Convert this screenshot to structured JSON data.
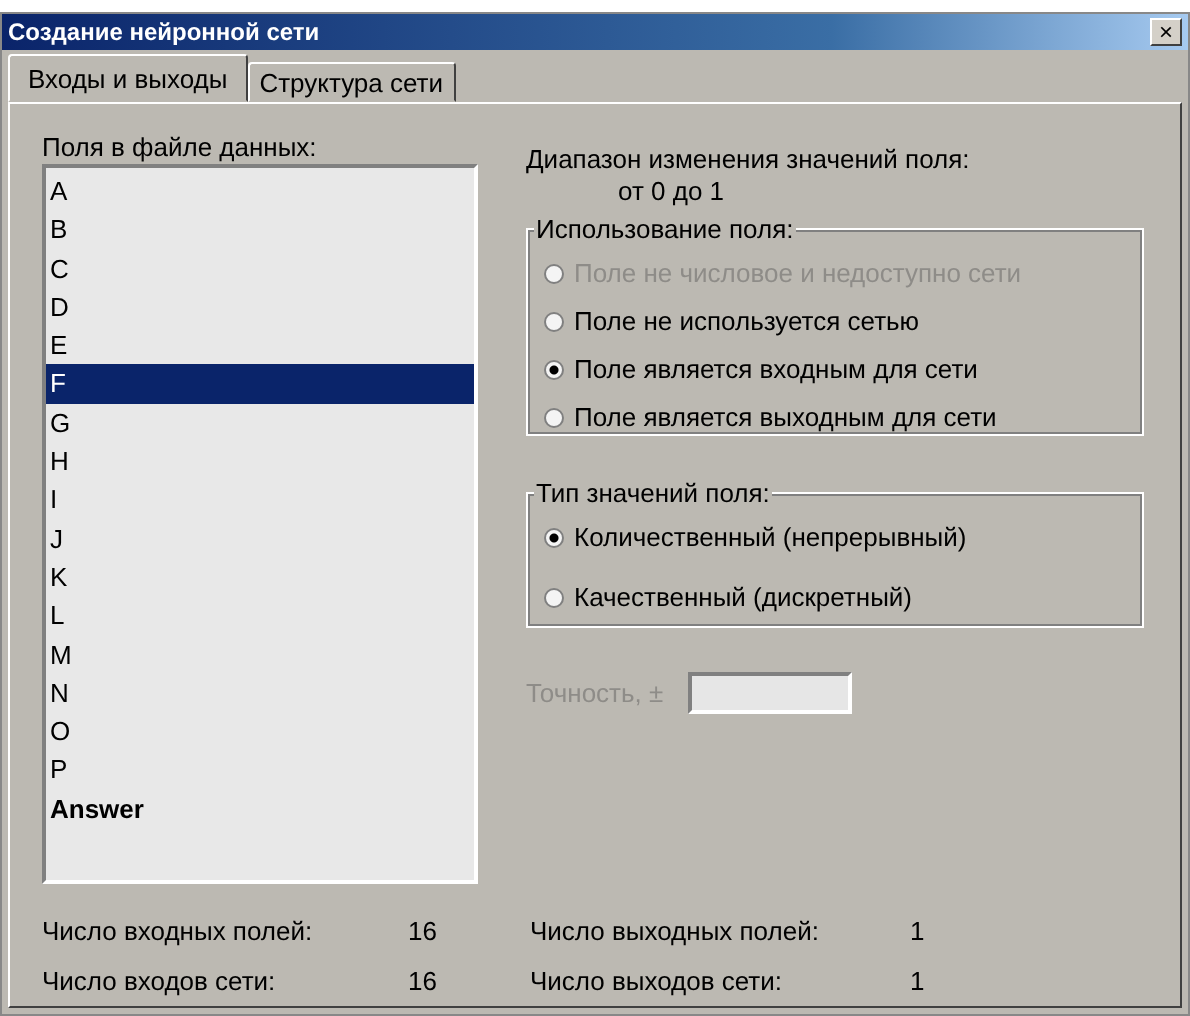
{
  "window": {
    "title": "Создание нейронной сети",
    "close": "×"
  },
  "tabs": [
    {
      "label": "Входы и выходы",
      "selected": true
    },
    {
      "label": "Структура сети",
      "selected": false
    }
  ],
  "fields": {
    "label": "Поля в файле данных:",
    "items": [
      {
        "name": "A",
        "kind": "field",
        "selected": false
      },
      {
        "name": "B",
        "kind": "field",
        "selected": false
      },
      {
        "name": "C",
        "kind": "field",
        "selected": false
      },
      {
        "name": "D",
        "kind": "field",
        "selected": false
      },
      {
        "name": "E",
        "kind": "field",
        "selected": false
      },
      {
        "name": "F",
        "kind": "field",
        "selected": true
      },
      {
        "name": "G",
        "kind": "field",
        "selected": false
      },
      {
        "name": "H",
        "kind": "field",
        "selected": false
      },
      {
        "name": "I",
        "kind": "field",
        "selected": false
      },
      {
        "name": "J",
        "kind": "field",
        "selected": false
      },
      {
        "name": "K",
        "kind": "field",
        "selected": false
      },
      {
        "name": "L",
        "kind": "field",
        "selected": false
      },
      {
        "name": "M",
        "kind": "field",
        "selected": false
      },
      {
        "name": "N",
        "kind": "field",
        "selected": false
      },
      {
        "name": "O",
        "kind": "field",
        "selected": false
      },
      {
        "name": "P",
        "kind": "field",
        "selected": false
      },
      {
        "name": "Answer",
        "kind": "target",
        "selected": false
      }
    ]
  },
  "range": {
    "label": "Диапазон изменения значений поля:",
    "value": "от 0 до 1"
  },
  "usage": {
    "title": "Использование поля:",
    "options": [
      {
        "label": "Поле не числовое и недоступно сети",
        "selected": false,
        "disabled": true
      },
      {
        "label": "Поле не используется сетью",
        "selected": false,
        "disabled": false
      },
      {
        "label": "Поле является входным для сети",
        "selected": true,
        "disabled": false
      },
      {
        "label": "Поле является выходным для сети",
        "selected": false,
        "disabled": false
      }
    ]
  },
  "value_type": {
    "title": "Тип значений поля:",
    "options": [
      {
        "label": "Количественный (непрерывный)",
        "selected": true,
        "disabled": false
      },
      {
        "label": "Качественный (дискретный)",
        "selected": false,
        "disabled": false
      }
    ]
  },
  "precision": {
    "label": "Точность, ±",
    "disabled": true
  },
  "stats": [
    {
      "label": "Число входных полей:",
      "value": "16"
    },
    {
      "label": "Число выходных полей:",
      "value": "1"
    },
    {
      "label": "Число входов сети:",
      "value": "16"
    },
    {
      "label": "Число выходов сети:",
      "value": "1"
    }
  ]
}
